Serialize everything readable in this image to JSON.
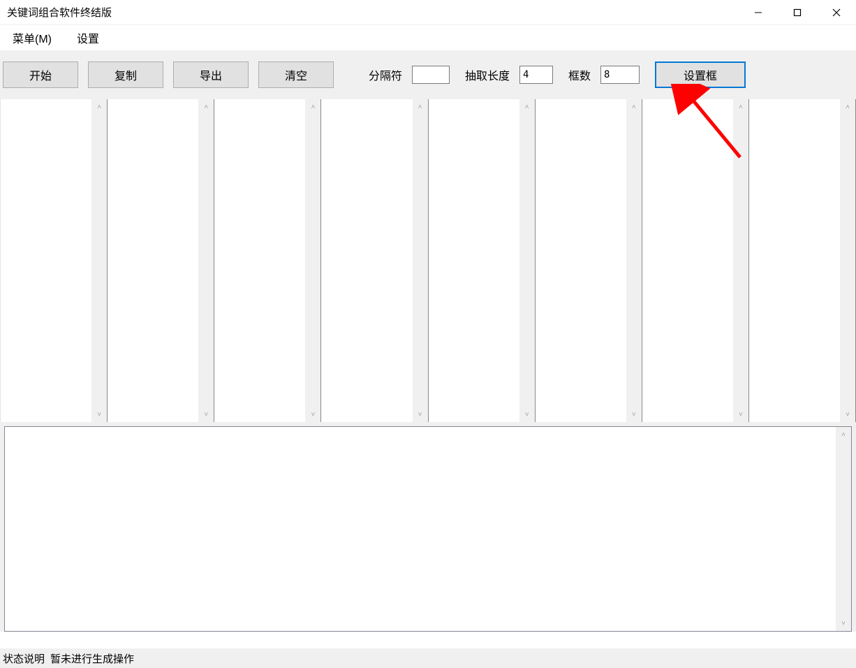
{
  "window": {
    "title": "关键词组合软件终结版"
  },
  "menus": {
    "menu": "菜单(M)",
    "settings": "设置"
  },
  "toolbar": {
    "start": "开始",
    "copy": "复制",
    "export": "导出",
    "clear": "清空",
    "separator_label": "分隔符",
    "separator_value": "",
    "extract_length_label": "抽取长度",
    "extract_length_value": "4",
    "box_count_label": "框数",
    "box_count_value": "8",
    "set_box": "设置框"
  },
  "columns": {
    "count": 8
  },
  "output": {
    "value": ""
  },
  "status": {
    "label": "状态说明",
    "message": "暂未进行生成操作"
  },
  "annotation": {
    "arrow_color": "#ff0000"
  }
}
